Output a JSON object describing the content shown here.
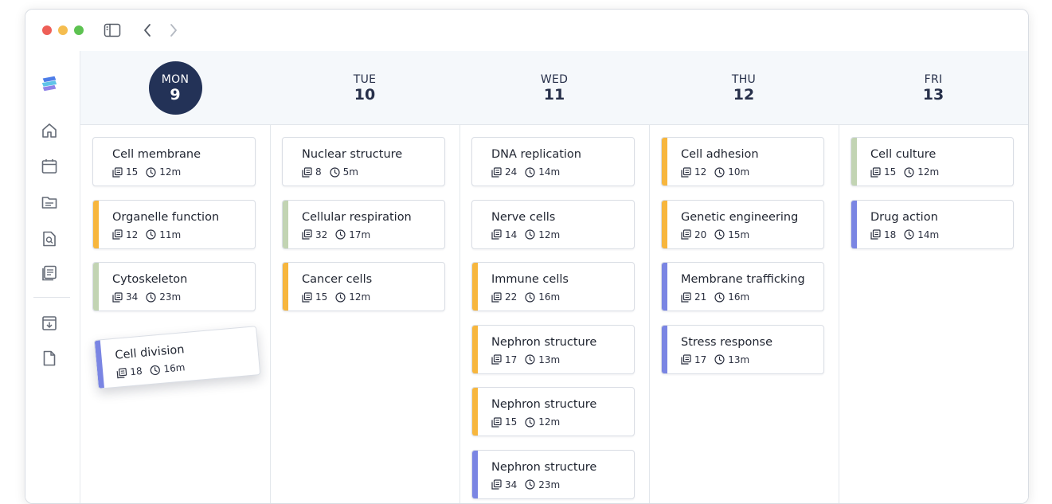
{
  "days": [
    {
      "name": "MON",
      "num": "9"
    },
    {
      "name": "TUE",
      "num": "10"
    },
    {
      "name": "WED",
      "num": "11"
    },
    {
      "name": "THU",
      "num": "12"
    },
    {
      "name": "FRI",
      "num": "13"
    }
  ],
  "active_day": "MON",
  "accent_colors": {
    "orange": "#f7b63d",
    "green": "#c2d4b3",
    "blue": "#7a85e3",
    "header_circle": "#233257"
  },
  "columns": [
    {
      "cards": [
        {
          "title": "Cell membrane",
          "cards_count": "15",
          "duration": "12m",
          "accent": ""
        },
        {
          "title": "Organelle function",
          "cards_count": "12",
          "duration": "11m",
          "accent": "orange"
        },
        {
          "title": "Cytoskeleton",
          "cards_count": "34",
          "duration": "23m",
          "accent": "green"
        },
        {
          "title": "Cell division",
          "cards_count": "18",
          "duration": "16m",
          "accent": "blue",
          "dragging": true
        }
      ]
    },
    {
      "cards": [
        {
          "title": "Nuclear structure",
          "cards_count": "8",
          "duration": "5m",
          "accent": ""
        },
        {
          "title": "Cellular respiration",
          "cards_count": "32",
          "duration": "17m",
          "accent": "green"
        },
        {
          "title": "Cancer cells",
          "cards_count": "15",
          "duration": "12m",
          "accent": "orange"
        }
      ]
    },
    {
      "cards": [
        {
          "title": "DNA replication",
          "cards_count": "24",
          "duration": "14m",
          "accent": ""
        },
        {
          "title": "Nerve cells",
          "cards_count": "14",
          "duration": "12m",
          "accent": ""
        },
        {
          "title": "Immune cells",
          "cards_count": "22",
          "duration": "16m",
          "accent": "orange"
        },
        {
          "title": "Nephron structure",
          "cards_count": "17",
          "duration": "13m",
          "accent": "orange"
        },
        {
          "title": "Nephron structure",
          "cards_count": "15",
          "duration": "12m",
          "accent": "orange"
        },
        {
          "title": "Nephron structure",
          "cards_count": "34",
          "duration": "23m",
          "accent": "blue"
        }
      ]
    },
    {
      "cards": [
        {
          "title": "Cell adhesion",
          "cards_count": "12",
          "duration": "10m",
          "accent": "orange"
        },
        {
          "title": "Genetic engineering",
          "cards_count": "20",
          "duration": "15m",
          "accent": "orange"
        },
        {
          "title": "Membrane trafficking",
          "cards_count": "21",
          "duration": "16m",
          "accent": "blue"
        },
        {
          "title": "Stress response",
          "cards_count": "17",
          "duration": "13m",
          "accent": "blue"
        }
      ]
    },
    {
      "cards": [
        {
          "title": "Cell culture",
          "cards_count": "15",
          "duration": "12m",
          "accent": "green"
        },
        {
          "title": "Drug action",
          "cards_count": "18",
          "duration": "14m",
          "accent": "blue"
        }
      ]
    }
  ],
  "sidebar_icons": [
    "logo-icon",
    "home-icon",
    "calendar-icon",
    "folder-icon",
    "search-document-icon",
    "notes-icon",
    "archive-download-icon",
    "file-icon"
  ],
  "toolbar_icons": [
    "sidebar-toggle-icon",
    "back-chevron-icon",
    "forward-chevron-icon"
  ]
}
